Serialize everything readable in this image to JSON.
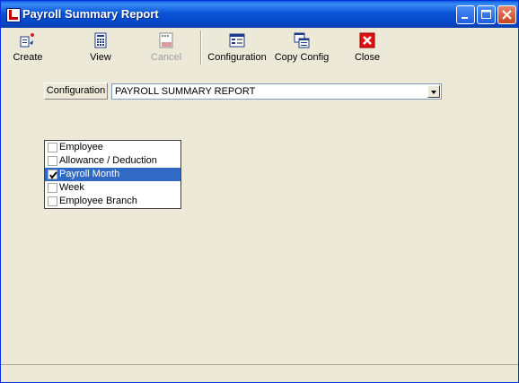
{
  "window": {
    "title": "Payroll Summary Report"
  },
  "toolbar": {
    "create": "Create",
    "view": "View",
    "cancel": "Cancel",
    "configuration": "Configuration",
    "copy_config": "Copy Config",
    "close": "Close"
  },
  "form": {
    "configuration_label": "Configuration",
    "configuration_value": "PAYROLL SUMMARY REPORT"
  },
  "groups": [
    {
      "label": "Employee",
      "checked": false,
      "selected": false
    },
    {
      "label": "Allowance / Deduction",
      "checked": false,
      "selected": false
    },
    {
      "label": "Payroll Month",
      "checked": true,
      "selected": true
    },
    {
      "label": "Week",
      "checked": false,
      "selected": false
    },
    {
      "label": "Employee Branch",
      "checked": false,
      "selected": false
    }
  ],
  "colors": {
    "title_bar": "#0a55d8",
    "selection": "#316ac5",
    "window_bg": "#ece9d8"
  }
}
